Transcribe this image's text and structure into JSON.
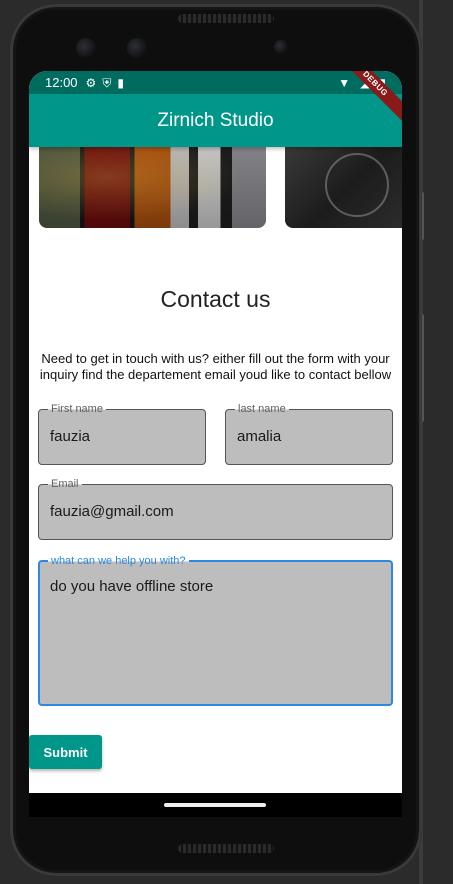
{
  "status_bar": {
    "time": "12:00",
    "left_icons": [
      "settings-icon",
      "shield-icon",
      "sd-card-icon"
    ],
    "right_icons": [
      "wifi-icon",
      "signal-icon",
      "battery-icon"
    ]
  },
  "app_bar": {
    "title": "Zirnich Studio"
  },
  "debug_banner": "DEBUG",
  "carousel": {
    "slides": [
      "guitars-image",
      "drums-image"
    ]
  },
  "contact": {
    "title": "Contact us",
    "intro": "Need to get in touch with us? either fill out the form with your inquiry find the departement email youd like to contact bellow"
  },
  "form": {
    "first_name": {
      "label": "First name",
      "value": "fauzia"
    },
    "last_name": {
      "label": "last name",
      "value": "amalia"
    },
    "email": {
      "label": "Email",
      "value": "fauzia@gmail.com"
    },
    "message": {
      "label": "what can we help you with?",
      "value": "do you have offline store"
    },
    "submit_label": "Submit"
  },
  "colors": {
    "primary": "#00968a",
    "status_bar": "#006c60",
    "field_fill": "#bdbdbd",
    "focus": "#2a89e0"
  }
}
